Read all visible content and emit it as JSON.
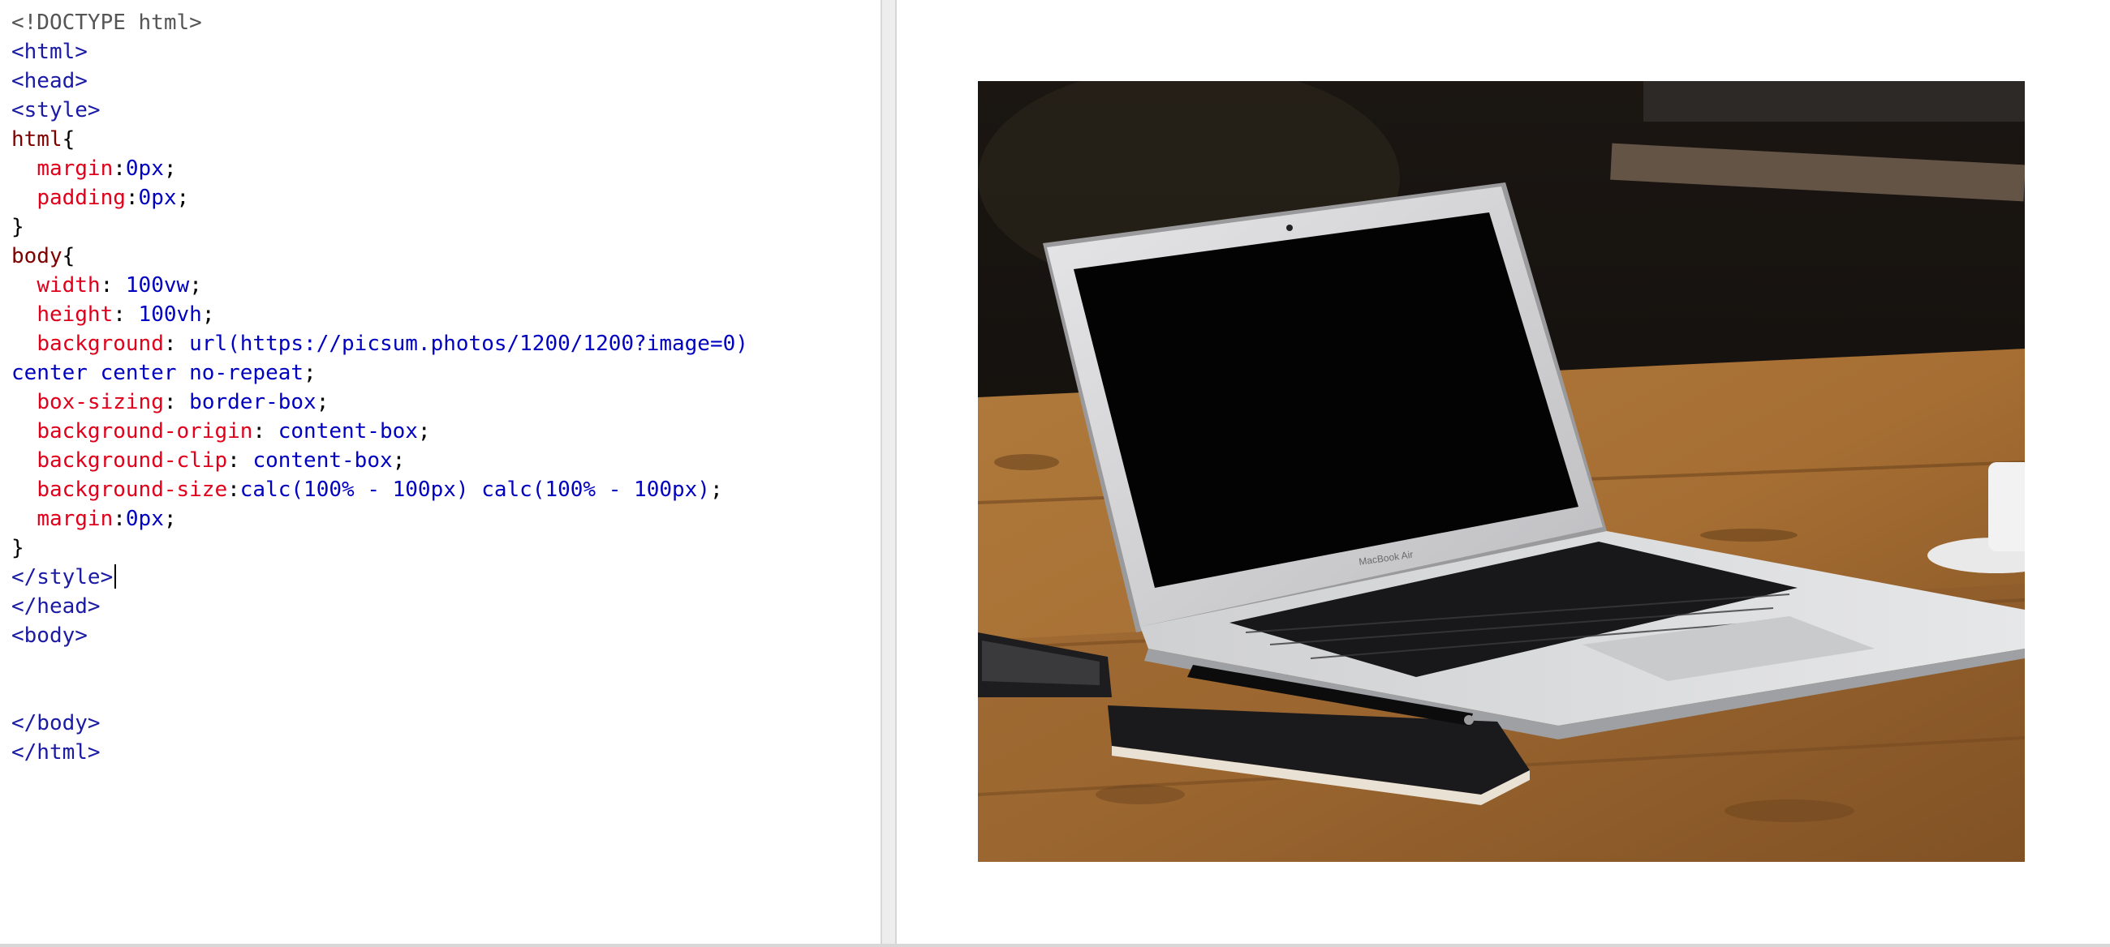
{
  "editor": {
    "lines": [
      [
        [
          "gray",
          "<!DOCTYPE html>"
        ]
      ],
      [
        [
          "tagb",
          "<html>"
        ]
      ],
      [
        [
          "tagb",
          "<head>"
        ]
      ],
      [
        [
          "tagb",
          "<style>"
        ]
      ],
      [
        [
          "sel",
          "html"
        ],
        [
          "plain",
          "{"
        ]
      ],
      [
        [
          "plain",
          "  "
        ],
        [
          "prop",
          "margin"
        ],
        [
          "plain",
          ":"
        ],
        [
          "val",
          "0px"
        ],
        [
          "plain",
          ";"
        ]
      ],
      [
        [
          "plain",
          "  "
        ],
        [
          "prop",
          "padding"
        ],
        [
          "plain",
          ":"
        ],
        [
          "val",
          "0px"
        ],
        [
          "plain",
          ";"
        ]
      ],
      [
        [
          "plain",
          "}"
        ]
      ],
      [
        [
          "sel",
          "body"
        ],
        [
          "plain",
          "{"
        ]
      ],
      [
        [
          "plain",
          "  "
        ],
        [
          "prop",
          "width"
        ],
        [
          "plain",
          ": "
        ],
        [
          "val",
          "100vw"
        ],
        [
          "plain",
          ";"
        ]
      ],
      [
        [
          "plain",
          "  "
        ],
        [
          "prop",
          "height"
        ],
        [
          "plain",
          ": "
        ],
        [
          "val",
          "100vh"
        ],
        [
          "plain",
          ";"
        ]
      ],
      [
        [
          "plain",
          "  "
        ],
        [
          "prop",
          "background"
        ],
        [
          "plain",
          ": "
        ],
        [
          "val",
          "url(https://picsum.photos/1200/1200?image=0)"
        ]
      ],
      [
        [
          "val",
          "center center no-repeat"
        ],
        [
          "plain",
          ";"
        ]
      ],
      [
        [
          "plain",
          "  "
        ],
        [
          "prop",
          "box-sizing"
        ],
        [
          "plain",
          ": "
        ],
        [
          "val",
          "border-box"
        ],
        [
          "plain",
          ";"
        ]
      ],
      [
        [
          "plain",
          "  "
        ],
        [
          "prop",
          "background-origin"
        ],
        [
          "plain",
          ": "
        ],
        [
          "val",
          "content-box"
        ],
        [
          "plain",
          ";"
        ]
      ],
      [
        [
          "plain",
          "  "
        ],
        [
          "prop",
          "background-clip"
        ],
        [
          "plain",
          ": "
        ],
        [
          "val",
          "content-box"
        ],
        [
          "plain",
          ";"
        ]
      ],
      [
        [
          "plain",
          "  "
        ],
        [
          "prop",
          "background-size"
        ],
        [
          "plain",
          ":"
        ],
        [
          "val",
          "calc(100% - 100px) calc(100% - 100px)"
        ],
        [
          "plain",
          ";"
        ]
      ],
      [
        [
          "plain",
          "  "
        ],
        [
          "prop",
          "margin"
        ],
        [
          "plain",
          ":"
        ],
        [
          "val",
          "0px"
        ],
        [
          "plain",
          ";"
        ]
      ],
      [
        [
          "plain",
          "}"
        ]
      ],
      [
        [
          "tagb",
          "</style>"
        ],
        [
          "caret",
          ""
        ]
      ],
      [
        [
          "tagb",
          "</head>"
        ]
      ],
      [
        [
          "tagb",
          "<body>"
        ]
      ],
      [
        [
          "plain",
          ""
        ]
      ],
      [
        [
          "plain",
          ""
        ]
      ],
      [
        [
          "tagb",
          "</body>"
        ]
      ],
      [
        [
          "tagb",
          "</html>"
        ]
      ]
    ]
  },
  "preview": {
    "image_subject": "laptop-on-wooden-table",
    "laptop_brand_label": "MacBook Air"
  },
  "colors": {
    "property": "#e0001b",
    "value": "#0000c0",
    "tag": "#1a1aa6",
    "selector": "#800000",
    "splitter": "#ededed"
  }
}
